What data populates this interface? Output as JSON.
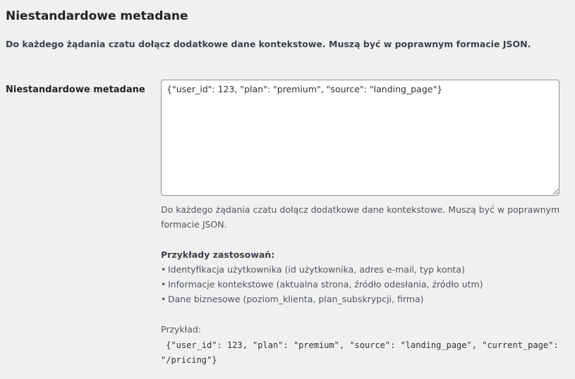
{
  "section": {
    "title": "Niestandardowe metadane",
    "description": "Do każdego żądania czatu dołącz dodatkowe dane kontekstowe. Muszą być w poprawnym formacie JSON."
  },
  "field": {
    "label": "Niestandardowe metadane",
    "value": "{\"user_id\": 123, \"plan\": \"premium\", \"source\": \"landing_page\"}",
    "help_line1": "Do każdego żądania czatu dołącz dodatkowe dane kontekstowe. Muszą być w poprawnym formacie JSON."
  },
  "examples": {
    "heading": "Przykłady zastosowań:",
    "bullet_glyph": "•",
    "items": [
      "Identyfikacja użytkownika (id użytkownika, adres e-mail, typ konta)",
      "Informacje kontekstowe (aktualna strona, źródło odesłania, źródło utm)",
      "Dane biznesowe (poziom_klienta, plan_subskrypcji, firma)"
    ]
  },
  "example": {
    "label": "Przykład:",
    "code": " {\"user_id\": 123, \"plan\": \"premium\", \"source\": \"landing_page\", \"current_page\": \"/pricing\"}"
  },
  "colors": {
    "background": "#f0f0f1",
    "text": "#3c434a",
    "heading": "#1d2327",
    "border": "#8c8f94"
  }
}
